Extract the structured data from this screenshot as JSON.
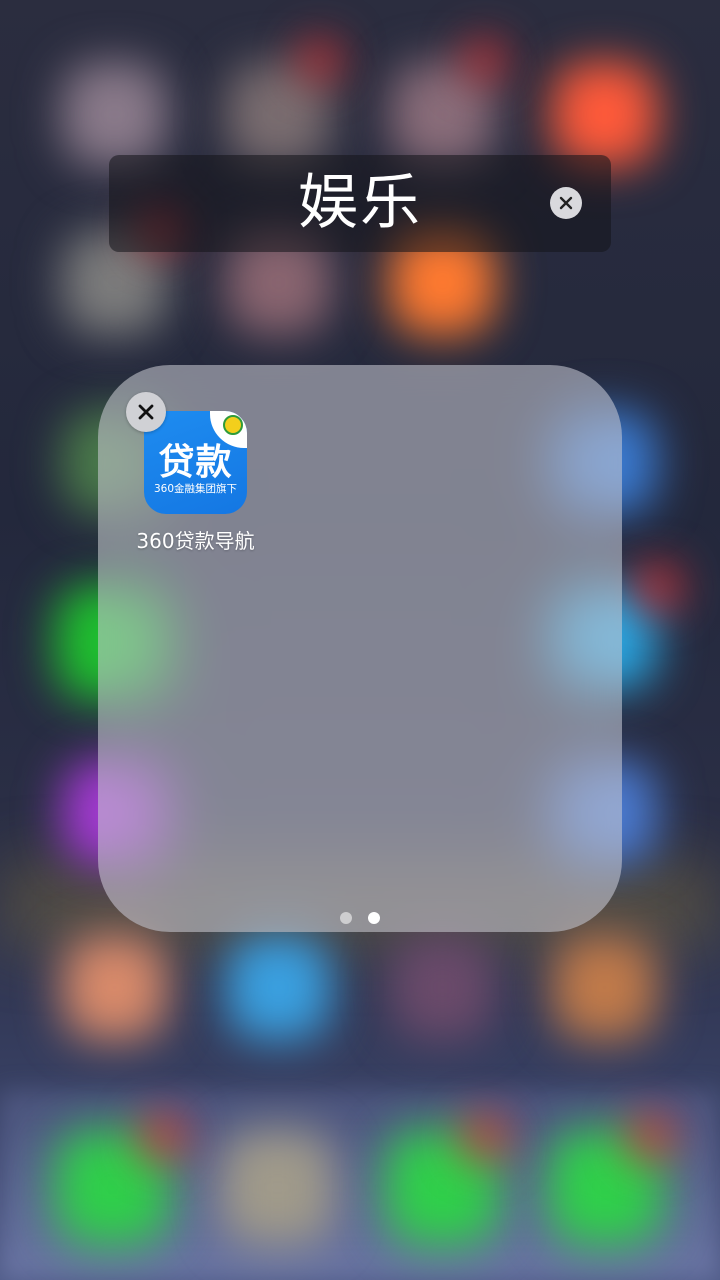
{
  "folder": {
    "title": "娱乐",
    "clear_icon": "close-icon"
  },
  "apps": [
    {
      "label": "360贷款导航",
      "icon_text": "贷款",
      "icon_subtext": "360金融集团旗下",
      "icon_color": "#1a82ea",
      "delete_icon": "close-icon"
    }
  ],
  "pagination": {
    "total_pages": 2,
    "current_page": 2
  },
  "colors": {
    "folder_panel": "#cdcdd7",
    "title_bar": "#141419",
    "accent_blue": "#1a82ea"
  }
}
